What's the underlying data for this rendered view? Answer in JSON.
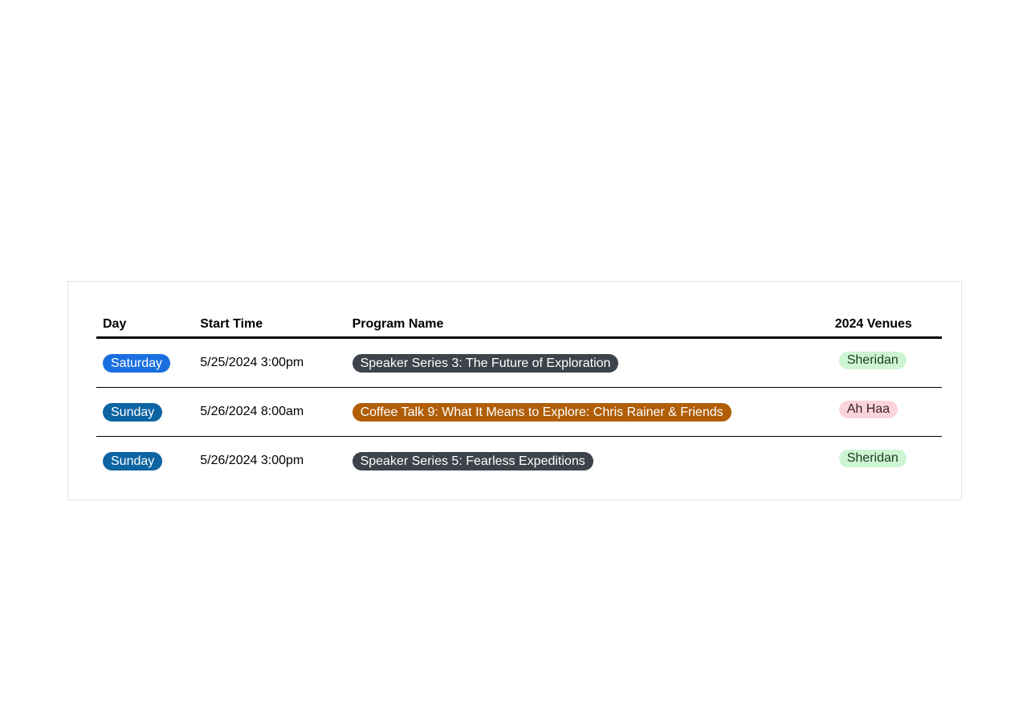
{
  "table": {
    "headers": {
      "day": "Day",
      "start_time": "Start Time",
      "program_name": "Program Name",
      "venues": "2024 Venues"
    },
    "rows": [
      {
        "day": "Saturday",
        "day_color": "#1a6fe0",
        "start_time": "5/25/2024 3:00pm",
        "program": "Speaker Series 3: The Future of Exploration",
        "program_color": "#3d434b",
        "venue": "Sheridan",
        "venue_color": "#cdf5d3"
      },
      {
        "day": "Sunday",
        "day_color": "#0d64a3",
        "start_time": "5/26/2024 8:00am",
        "program": "Coffee Talk 9: What It Means to Explore: Chris Rainer & Friends",
        "program_color": "#b05e07",
        "venue": "Ah Haa",
        "venue_color": "#fbd3dc"
      },
      {
        "day": "Sunday",
        "day_color": "#0d64a3",
        "start_time": "5/26/2024 3:00pm",
        "program": "Speaker Series 5: Fearless Expeditions",
        "program_color": "#3d434b",
        "venue": "Sheridan",
        "venue_color": "#cdf5d3"
      }
    ]
  }
}
